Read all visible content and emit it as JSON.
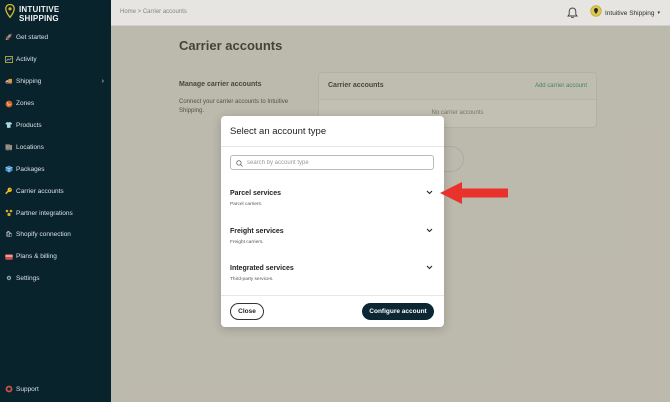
{
  "brand": {
    "line1": "INTUITIVE",
    "line2": "SHIPPING"
  },
  "sidebar": {
    "items": [
      {
        "label": "Get started",
        "icon": "rocket-icon"
      },
      {
        "label": "Activity",
        "icon": "chart-icon"
      },
      {
        "label": "Shipping",
        "icon": "truck-icon",
        "has_chevron": true
      },
      {
        "label": "Zones",
        "icon": "globe-icon"
      },
      {
        "label": "Products",
        "icon": "shirt-icon"
      },
      {
        "label": "Locations",
        "icon": "building-icon"
      },
      {
        "label": "Packages",
        "icon": "box-icon"
      },
      {
        "label": "Carrier accounts",
        "icon": "key-icon"
      },
      {
        "label": "Partner integrations",
        "icon": "puzzle-icon"
      },
      {
        "label": "Shopify connection",
        "icon": "bag-icon"
      },
      {
        "label": "Plans & billing",
        "icon": "card-icon"
      },
      {
        "label": "Settings",
        "icon": "gear-icon"
      }
    ],
    "support": "Support"
  },
  "topbar": {
    "breadcrumb": "Home > Carrier accounts",
    "account_name": "Intuitive Shipping"
  },
  "page": {
    "title": "Carrier accounts",
    "section_title": "Manage carrier accounts",
    "section_desc": "Connect your carrier accounts to Intuitive Shipping.",
    "card_title": "Carrier accounts",
    "card_link": "Add carrier account",
    "card_empty": "No carrier accounts"
  },
  "modal": {
    "title": "Select an account type",
    "search_placeholder": "search by account type",
    "options": [
      {
        "title": "Parcel services",
        "subtitle": "Parcel carriers."
      },
      {
        "title": "Freight services",
        "subtitle": "Freight carriers."
      },
      {
        "title": "Integrated services",
        "subtitle": "Third-party services."
      }
    ],
    "close_label": "Close",
    "configure_label": "Configure account"
  },
  "colors": {
    "sidebar_bg": "#0a2530",
    "accent_teal": "#1f8a7a",
    "primary_button": "#0b2733",
    "annotation_arrow": "#e8322b"
  }
}
